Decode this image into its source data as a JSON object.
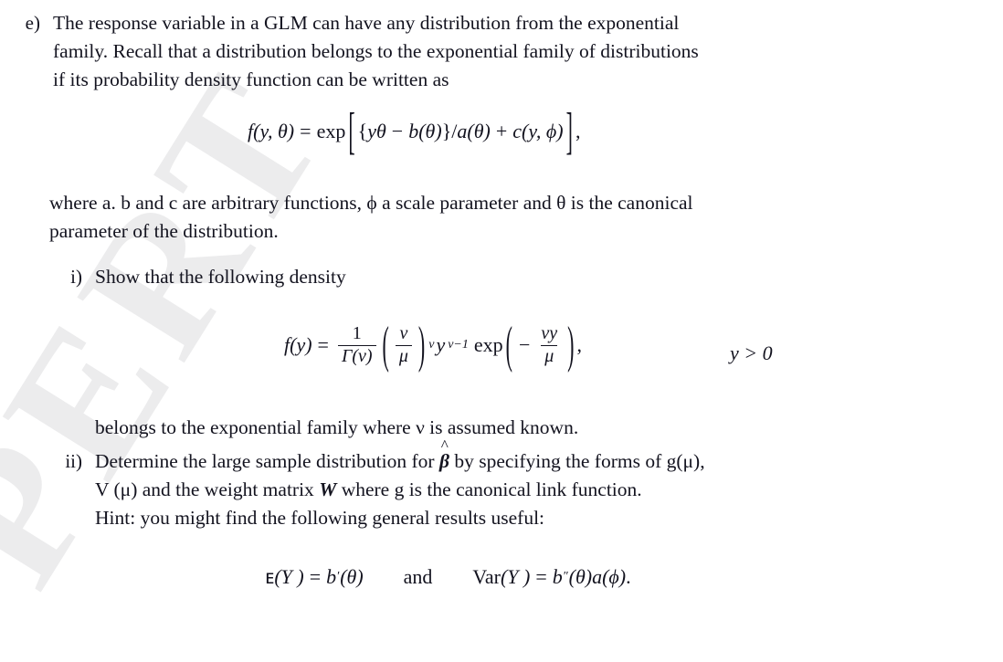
{
  "document": {
    "watermark_text": "PERT",
    "text_color": "#13131f",
    "watermark_color": "#ececed",
    "background_color": "#ffffff"
  },
  "item_e": {
    "marker": "e)",
    "lines": [
      "The response variable in a GLM can have any distribution from the exponential",
      "family. Recall that a distribution belongs to the exponential family of distributions",
      "if its probability density function can be written as"
    ]
  },
  "equation_1": {
    "lhs_f": "f",
    "lhs_args": "(y, θ)",
    "equals": "=",
    "exp": "exp",
    "bracket_open": "[",
    "brace_open": "{",
    "y_theta": "yθ",
    "minus": "−",
    "b_theta": "b(θ)",
    "brace_close": "}",
    "slash": "/",
    "a_theta": "a(θ)",
    "plus": "+",
    "c_y_phi": "c(y, ϕ)",
    "bracket_close": "]",
    "comma": ","
  },
  "where_paragraph": {
    "lines": [
      "where a. b and c are arbitrary functions, ϕ a scale parameter and θ is the canonical",
      "parameter of the distribution."
    ]
  },
  "item_i": {
    "marker": "i)",
    "lines": [
      "Show that the following density"
    ]
  },
  "equation_2": {
    "lhs": "f(y)",
    "equals": "=",
    "frac_num": "1",
    "frac_den": "Γ(ν)",
    "paren_open": "(",
    "inner_num": "ν",
    "inner_den": "μ",
    "paren_close": ")",
    "paren_exponent": "ν",
    "y_base": "y",
    "y_exponent": "ν−1",
    "exp": "exp",
    "exp_paren_open": "(",
    "neg": "−",
    "exp_num": "νy",
    "exp_den": "μ",
    "exp_paren_close": ")",
    "comma": ",",
    "condition": "y > 0"
  },
  "belongs_line": {
    "text": "belongs to the exponential family where ν is assumed known."
  },
  "item_ii": {
    "marker": "ii)",
    "line1_pre": "Determine the large sample distribution for ",
    "beta_hat": "β",
    "hat_symbol": "^",
    "line1_post": " by specifying the forms of g(μ),",
    "line2_pre": "V (μ) and the weight matrix ",
    "matrix_w": "W",
    "line2_post": " where g is the canonical link function.",
    "line3": "Hint: you might find the following general results useful:"
  },
  "equation_3": {
    "expectation_symbol": "ᴇ",
    "expectation_lhs": "(Y )",
    "equals_1": "=",
    "b_prime": "b",
    "prime_1": "′",
    "theta_1": "(θ)",
    "conjunction": "and",
    "var_label": "Var",
    "var_lhs": "(Y )",
    "equals_2": "=",
    "b_double": "b",
    "prime_2": "″",
    "theta_2": "(θ)",
    "a_phi": "a(ϕ)",
    "period": "."
  }
}
